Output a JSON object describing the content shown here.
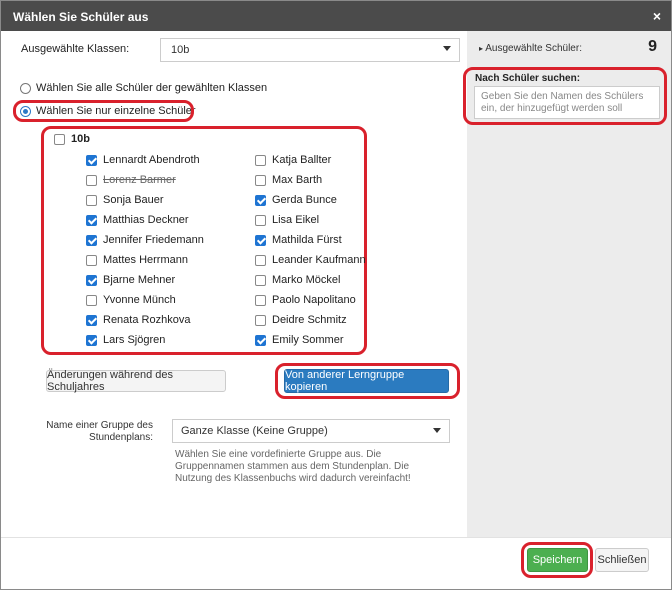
{
  "dialog": {
    "title": "Wählen Sie Schüler aus",
    "close_glyph": "×"
  },
  "classes": {
    "label": "Ausgewählte Klassen:",
    "value": "10b"
  },
  "modes": {
    "all_label": "Wählen Sie alle Schüler der gewählten Klassen",
    "single_label": "Wählen Sie nur einzelne Schüler",
    "selected": "single"
  },
  "group": {
    "name": "10b",
    "checked": false,
    "students": [
      {
        "name": "Lennardt Abendroth",
        "checked": true,
        "struck": false
      },
      {
        "name": "Katja Ballter",
        "checked": false,
        "struck": false
      },
      {
        "name": "Lorenz Barmer",
        "checked": false,
        "struck": true
      },
      {
        "name": "Max Barth",
        "checked": false,
        "struck": false
      },
      {
        "name": "Sonja Bauer",
        "checked": false,
        "struck": false
      },
      {
        "name": "Gerda Bunce",
        "checked": true,
        "struck": false
      },
      {
        "name": "Matthias Deckner",
        "checked": true,
        "struck": false
      },
      {
        "name": "Lisa Eikel",
        "checked": false,
        "struck": false
      },
      {
        "name": "Jennifer Friedemann",
        "checked": true,
        "struck": false
      },
      {
        "name": "Mathilda Fürst",
        "checked": true,
        "struck": false
      },
      {
        "name": "Mattes Herrmann",
        "checked": false,
        "struck": false
      },
      {
        "name": "Leander Kaufmann",
        "checked": false,
        "struck": false
      },
      {
        "name": "Bjarne Mehner",
        "checked": true,
        "struck": false
      },
      {
        "name": "Marko Möckel",
        "checked": false,
        "struck": false
      },
      {
        "name": "Yvonne Münch",
        "checked": false,
        "struck": false
      },
      {
        "name": "Paolo Napolitano",
        "checked": false,
        "struck": false
      },
      {
        "name": "Renata Rozhkova",
        "checked": true,
        "struck": false
      },
      {
        "name": "Deidre Schmitz",
        "checked": false,
        "struck": false
      },
      {
        "name": "Lars Sjögren",
        "checked": true,
        "struck": false
      },
      {
        "name": "Emily Sommer",
        "checked": true,
        "struck": false
      }
    ]
  },
  "buttons": {
    "changes": "Änderungen während des Schuljahres",
    "copy": "Von anderer Lerngruppe kopieren",
    "save": "Speichern",
    "close": "Schließen"
  },
  "plan": {
    "label": "Name einer Gruppe des Stundenplans:",
    "value": "Ganze Klasse (Keine Gruppe)",
    "help": "Wählen Sie eine vordefinierte Gruppe aus. Die Gruppennamen stammen aus dem Stundenplan. Die Nutzung des Klassenbuchs wird dadurch vereinfacht!"
  },
  "sidebar": {
    "selected_label": "Ausgewählte Schüler:",
    "selected_count": "9",
    "search_label": "Nach Schüler suchen:",
    "search_placeholder": "Geben Sie den Namen des Schülers ein, der hinzugefügt werden soll",
    "search_value": ""
  },
  "colors": {
    "highlight": "#d9212c",
    "primary": "#2b7bc0",
    "success": "#4caf50",
    "header": "#4b4b4b"
  }
}
